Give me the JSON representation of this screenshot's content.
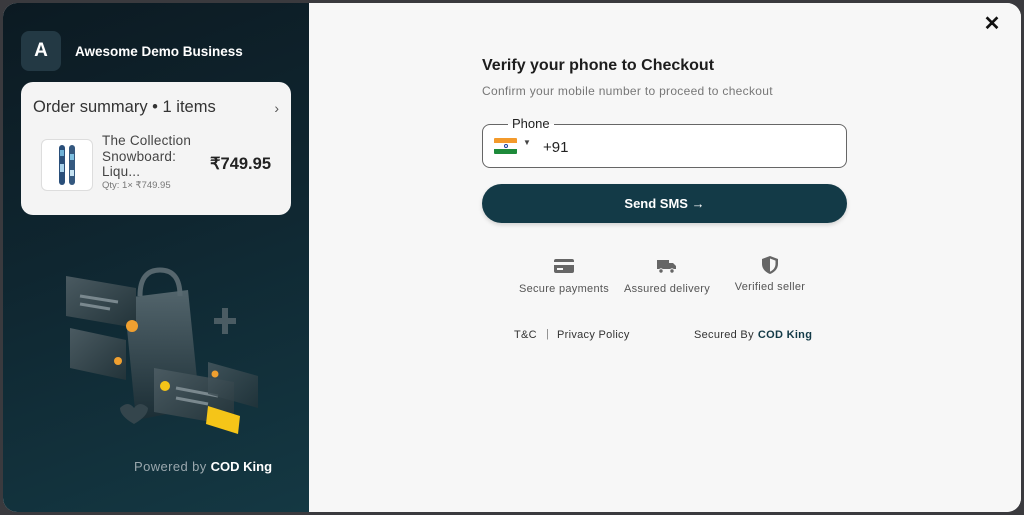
{
  "brand": {
    "initial": "A",
    "name": "Awesome Demo Business"
  },
  "order_summary": {
    "heading": "Order summary • 1 items",
    "chevron": "›",
    "item": {
      "title": "The Collection Snowboard: Liqu...",
      "qty": "Qty: 1× ₹749.95",
      "price": "₹749.95"
    }
  },
  "powered_by": {
    "prefix": "Powered by",
    "name": "COD King"
  },
  "close_icon": "✕",
  "verify": {
    "title": "Verify your phone to Checkout",
    "subtitle": "Confirm your mobile number to proceed to checkout"
  },
  "phone": {
    "label": "Phone",
    "country_flag": "india-flag-icon",
    "value": "+91"
  },
  "send_button": "Send SMS →",
  "badges": [
    {
      "icon": "credit-card-icon",
      "label": "Secure payments"
    },
    {
      "icon": "truck-icon",
      "label": "Assured delivery"
    },
    {
      "icon": "shield-icon",
      "label": "Verified seller"
    }
  ],
  "footer": {
    "terms": "T&C",
    "separator": "|",
    "privacy": "Privacy Policy",
    "secured_by": "Secured By",
    "secured_brand": "COD King"
  },
  "colors": {
    "primary": "#133a47",
    "panel_dark": "#0f2630",
    "accent_orange": "#f0a030",
    "accent_yellow": "#f5c518"
  }
}
